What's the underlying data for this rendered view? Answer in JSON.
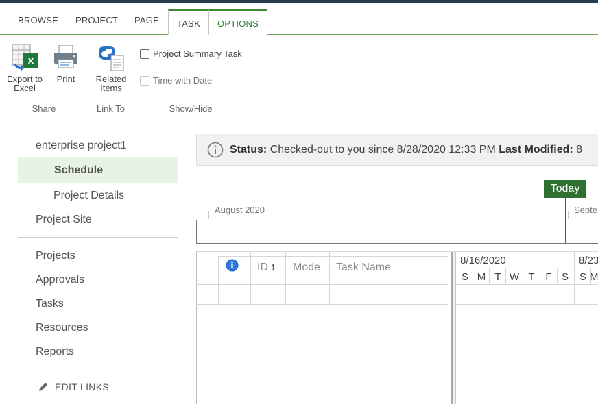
{
  "ribbon": {
    "tabs": [
      {
        "label": "BROWSE"
      },
      {
        "label": "PROJECT"
      },
      {
        "label": "PAGE"
      },
      {
        "label": "TASK"
      },
      {
        "label": "OPTIONS"
      }
    ],
    "active_tab": "OPTIONS",
    "groups": {
      "share": {
        "label": "Share",
        "export_label": "Export to Excel",
        "print_label": "Print"
      },
      "link_to": {
        "label": "Link To",
        "related_label": "Related Items"
      },
      "show_hide": {
        "label": "Show/Hide",
        "summary_task": {
          "label": "Project Summary Task",
          "checked": false,
          "enabled": true
        },
        "time_with_date": {
          "label": "Time with Date",
          "checked": false,
          "enabled": false
        }
      }
    }
  },
  "nav": {
    "project": "enterprise project1",
    "schedule": "Schedule",
    "project_details": "Project Details",
    "project_site": "Project Site",
    "projects": "Projects",
    "approvals": "Approvals",
    "tasks": "Tasks",
    "resources": "Resources",
    "reports": "Reports",
    "edit_links": "EDIT LINKS"
  },
  "status": {
    "label": "Status:",
    "text": "Checked-out to you since 8/28/2020 12:33 PM",
    "modified_label": "Last Modified:",
    "modified_value": "8"
  },
  "timeline": {
    "today": "Today",
    "month1": "August 2020",
    "month2": "Septe"
  },
  "grid": {
    "columns": {
      "id": "ID",
      "sort_arrow": "🠕",
      "mode": "Mode",
      "task_name": "Task Name"
    },
    "gantt": {
      "week1": "8/16/2020",
      "week2": "8/23",
      "days": [
        "S",
        "M",
        "T",
        "W",
        "T",
        "F",
        "S",
        "S",
        "M"
      ]
    }
  },
  "colors": {
    "accent": "#2e7d32",
    "today": "#2e7030",
    "nav_selected_bg": "#e8f4e3",
    "topbar": "#283c4c"
  }
}
